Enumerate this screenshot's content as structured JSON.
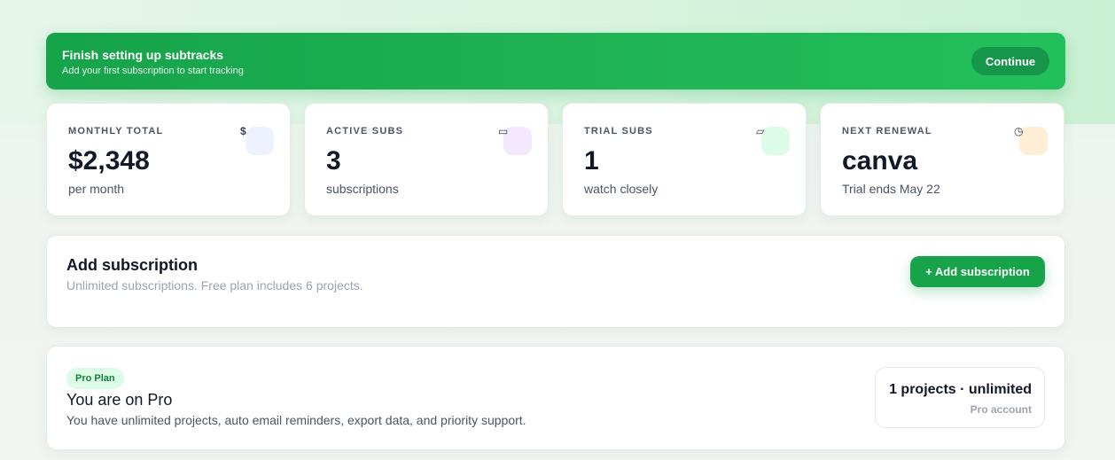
{
  "banner": {
    "title": "Finish setting up subtracks",
    "subtitle": "Add your first subscription to start tracking",
    "button_label": "Continue"
  },
  "stats": [
    {
      "label": "MONTHLY TOTAL",
      "value": "$2,348",
      "sub": "per month",
      "icon": "dollar-icon",
      "glyph": "$",
      "icon_bg": "#eef2ff"
    },
    {
      "label": "ACTIVE SUBS",
      "value": "3",
      "sub": "subscriptions",
      "icon": "card-icon",
      "glyph": "▭",
      "icon_bg": "#f3e8ff"
    },
    {
      "label": "TRIAL SUBS",
      "value": "1",
      "sub": "watch closely",
      "icon": "ticket-icon",
      "glyph": "▱",
      "icon_bg": "#dcfce7"
    },
    {
      "label": "NEXT RENEWAL",
      "value": "canva",
      "sub": "Trial ends May 22",
      "icon": "clock-icon",
      "glyph": "◷",
      "icon_bg": "#ffedd5"
    }
  ],
  "add_subscription": {
    "title": "Add subscription",
    "subtitle": "Unlimited subscriptions. Free plan includes 6 projects.",
    "button_label": "+ Add subscription"
  },
  "plan": {
    "badge": "Pro Plan",
    "title": "You are on Pro",
    "subtitle": "You have unlimited projects, auto email reminders, export data, and priority support.",
    "box_main": "1 projects · unlimited",
    "box_sub": "Pro account"
  },
  "colors": {
    "accent": "#16a34a",
    "accent_light": "#22c05a",
    "badge_bg": "#dcfce7"
  }
}
